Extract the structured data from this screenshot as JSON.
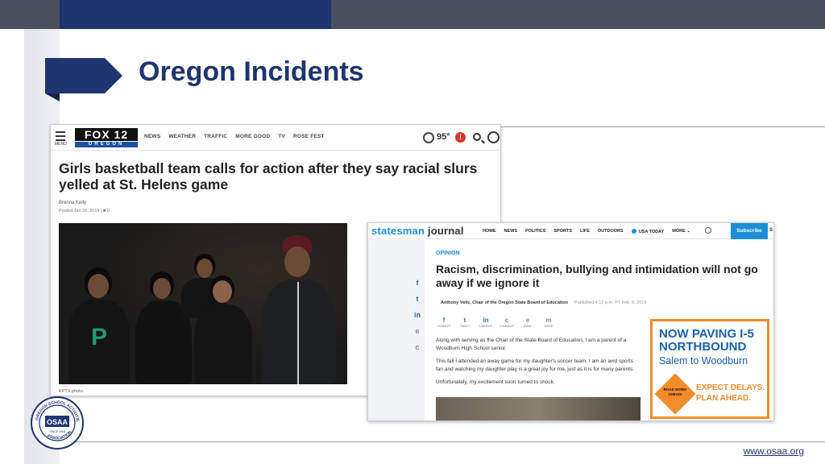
{
  "slide": {
    "title": "Oregon Incidents",
    "footer_link": "www.osaa.org"
  },
  "seal": {
    "text_top": "OREGON SCHOOL ACTIVITIES",
    "text_bottom": "ASSOCIATION",
    "center": "OSAA",
    "since": "SINCE 1918"
  },
  "fox": {
    "menu_label": "MENU",
    "logo_top": "FOX 12",
    "logo_bottom": "OREGON",
    "nav": [
      "NEWS",
      "WEATHER",
      "TRAFFIC",
      "MORE GOOD",
      "TV",
      "ROSE FEST"
    ],
    "temperature": "95°",
    "headline": "Girls basketball team calls for action after they say racial slurs yelled at St. Helens game",
    "author": "Brenna Kelly",
    "posted": "Posted Jan 20, 2019",
    "comments": "0",
    "photo_caption": "KPTV photo."
  },
  "statesman": {
    "logo_a": "statesman",
    "logo_b": " journal",
    "nav": [
      "HOME",
      "NEWS",
      "POLITICS",
      "SPORTS",
      "LIFE",
      "OUTDOORS"
    ],
    "usa_today": "USA TODAY",
    "more": "MORE",
    "subscribe": "Subscribe",
    "edge_letter": "S",
    "section": "OPINION",
    "headline": "Racism, discrimination, bullying and intimidation will not go away if we ignore it",
    "byline": "Anthony Veliz, Chair of the Oregon State Board of Education",
    "published": "Published 4:12 p.m. PT Feb. 8, 2019",
    "share": [
      {
        "icon": "f",
        "label": "CONNECT"
      },
      {
        "icon": "t",
        "label": "TWEET"
      },
      {
        "icon": "in",
        "label": "LINKEDIN"
      },
      {
        "icon": "c",
        "label": "COMMENT"
      },
      {
        "icon": "e",
        "label": "EMAIL"
      },
      {
        "icon": "m",
        "label": "MORE"
      }
    ],
    "side_icons": [
      "f",
      "t",
      "in",
      "e",
      "c"
    ],
    "paragraphs": [
      "Along with serving as the Chair of the State Board of Education, I am a parent of a Woodburn High School senior.",
      "This fall I attended an away game for my daughter's soccer team. I am an avid sports fan and watching my daughter play is a great joy for me, just as it is for many parents.",
      "Unfortunately, my excitement soon turned to shock."
    ],
    "ad": {
      "line1": "NOW PAVING I-5 NORTHBOUND",
      "line2": "Salem to Woodburn",
      "sign": "ROAD WORK AHEAD!",
      "line3": "EXPECT DELAYS. PLAN AHEAD."
    }
  },
  "colors": {
    "navy": "#1f3570",
    "gray_bar": "#4a4f5c",
    "statesman_blue": "#1c8fd6",
    "ad_orange": "#f28b2a"
  }
}
